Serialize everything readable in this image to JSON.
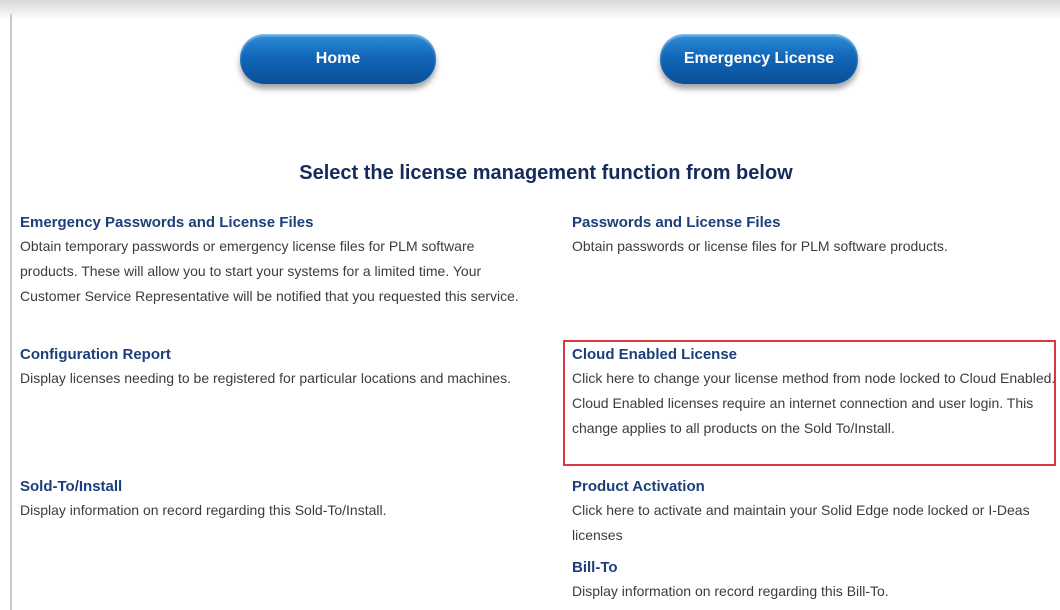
{
  "nav": {
    "home_label": "Home",
    "emergency_license_label": "Emergency License"
  },
  "heading": "Select the license management function from below",
  "left_items": [
    {
      "title": "Emergency Passwords and License Files",
      "description": "Obtain temporary passwords or emergency license files for PLM software products. These will allow you to start your systems for a limited time. Your Customer Service Representative will be notified that you requested this service."
    },
    {
      "title": "Configuration Report",
      "description": "Display licenses needing to be registered for particular locations and machines."
    },
    {
      "title": "Sold-To/Install",
      "description": "Display information on record regarding this Sold-To/Install."
    }
  ],
  "right_items": [
    {
      "title": "Passwords and License Files",
      "description": "Obtain passwords or license files for PLM software products."
    },
    {
      "title": "Cloud Enabled License",
      "description": "Click here to change your license method from node locked to Cloud Enabled. Cloud Enabled licenses require an internet connection and user login. This change applies to all products on the Sold To/Install."
    },
    {
      "title": "Product Activation",
      "description": "Click here to activate and maintain your Solid Edge node locked or I-Deas licenses"
    },
    {
      "title": "Bill-To",
      "description": "Display information on record regarding this Bill-To."
    }
  ],
  "colors": {
    "button_blue": "#1167b8",
    "title_navy": "#1c3f7a",
    "highlight_red": "#d9363e"
  }
}
